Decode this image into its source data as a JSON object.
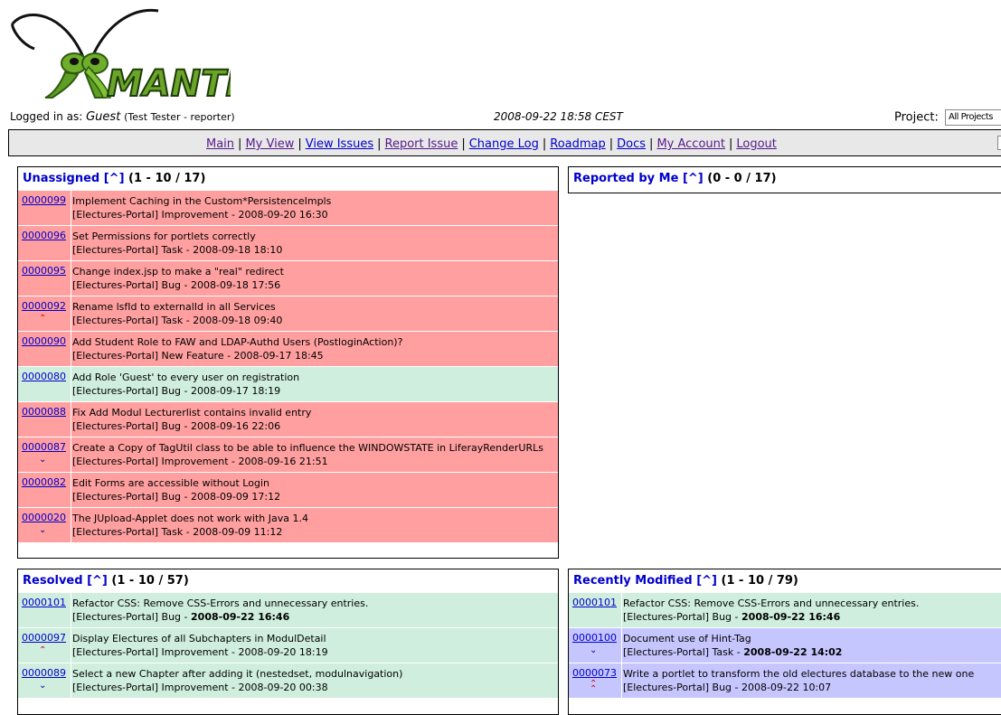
{
  "logo_text": "MANTIS",
  "login": {
    "label": "Logged in as:",
    "user": "Guest",
    "detail": "(Test Tester - reporter)",
    "datetime": "2008-09-22 18:58 CEST",
    "project_label": "Project:",
    "project_value": "All Projects"
  },
  "menu": [
    "Main",
    "My View",
    "View Issues",
    "Report Issue",
    "Change Log",
    "Roadmap",
    "Docs",
    "My Account",
    "Logout"
  ],
  "unassigned": {
    "title": "Unassigned",
    "link": "[^]",
    "count": "(1 - 10 / 17)",
    "rows": [
      {
        "id": "0000099",
        "summary": "Implement Caching in the Custom*PersistenceImpls",
        "meta": "[Electures-Portal] Improvement - 2008-09-20 16:30",
        "color": "red",
        "pri": ""
      },
      {
        "id": "0000096",
        "summary": "Set Permissions for portlets correctly",
        "meta": "[Electures-Portal] Task - 2008-09-18 18:10",
        "color": "red",
        "pri": ""
      },
      {
        "id": "0000095",
        "summary": "Change index.jsp to make a \"real\" redirect",
        "meta": "[Electures-Portal] Bug - 2008-09-18 17:56",
        "color": "red",
        "pri": ""
      },
      {
        "id": "0000092",
        "summary": "Rename lsfId to externalId in all Services",
        "meta": "[Electures-Portal] Task - 2008-09-18 09:40",
        "color": "red",
        "pri": "up"
      },
      {
        "id": "0000090",
        "summary": "Add Student Role to FAW and LDAP-Authd Users (PostloginAction)?",
        "meta": "[Electures-Portal] New Feature - 2008-09-17 18:45",
        "color": "red",
        "pri": ""
      },
      {
        "id": "0000080",
        "summary": "Add Role 'Guest' to every user on registration",
        "meta": "[Electures-Portal] Bug - 2008-09-17 18:19",
        "color": "green",
        "pri": ""
      },
      {
        "id": "0000088",
        "summary": "Fix Add Modul Lecturerlist contains invalid entry",
        "meta": "[Electures-Portal] Bug - 2008-09-16 22:06",
        "color": "red",
        "pri": ""
      },
      {
        "id": "0000087",
        "summary": "Create a Copy of TagUtil class to be able to influence the WINDOWSTATE in LiferayRenderURLs",
        "meta": "[Electures-Portal] Improvement - 2008-09-16 21:51",
        "color": "red",
        "pri": "down"
      },
      {
        "id": "0000082",
        "summary": "Edit Forms are accessible without Login",
        "meta": "[Electures-Portal] Bug - 2008-09-09 17:12",
        "color": "red",
        "pri": ""
      },
      {
        "id": "0000020",
        "summary": "The JUpload-Applet does not work with Java 1.4",
        "meta": "[Electures-Portal] Task - 2008-09-09 11:12",
        "color": "red",
        "pri": "down"
      }
    ]
  },
  "reported": {
    "title": "Reported by Me",
    "link": "[^]",
    "count": "(0 - 0 / 17)"
  },
  "resolved": {
    "title": "Resolved",
    "link": "[^]",
    "count": "(1 - 10 / 57)",
    "rows": [
      {
        "id": "0000101",
        "summary": "Refactor CSS: Remove CSS-Errors and unnecessary entries.",
        "meta_prefix": "[Electures-Portal] Bug - ",
        "meta_ts": "2008-09-22 16:46",
        "bold": true,
        "color": "green",
        "pri": ""
      },
      {
        "id": "0000097",
        "summary": "Display Electures of all Subchapters in ModulDetail",
        "meta_prefix": "[Electures-Portal] Improvement - ",
        "meta_ts": "2008-09-20 18:19",
        "bold": false,
        "color": "green",
        "pri": "up"
      },
      {
        "id": "0000089",
        "summary": "Select a new Chapter after adding it (nestedset, modulnavigation)",
        "meta_prefix": "[Electures-Portal] Improvement - ",
        "meta_ts": "2008-09-20 00:38",
        "bold": false,
        "color": "green",
        "pri": "down"
      }
    ]
  },
  "recent": {
    "title": "Recently Modified",
    "link": "[^]",
    "count": "(1 - 10 / 79)",
    "rows": [
      {
        "id": "0000101",
        "summary": "Refactor CSS: Remove CSS-Errors and unnecessary entries.",
        "meta_prefix": "[Electures-Portal] Bug - ",
        "meta_ts": "2008-09-22 16:46",
        "bold": true,
        "color": "green",
        "pri": ""
      },
      {
        "id": "0000100",
        "summary": "Document use of Hint-Tag",
        "meta_prefix": "[Electures-Portal] Task - ",
        "meta_ts": "2008-09-22 14:02",
        "bold": true,
        "color": "purple",
        "pri": "down"
      },
      {
        "id": "0000073",
        "summary": "Write a portlet to transform the old electures database to the new one",
        "meta_prefix": "[Electures-Portal] Bug - ",
        "meta_ts": "2008-09-22 10:07",
        "bold": false,
        "color": "purple",
        "pri": "upup"
      }
    ]
  },
  "colors": {
    "red": "#ff9f9f",
    "green": "#cfeedd",
    "purple": "#c6c6ff",
    "link": "#0000cc",
    "visited": "#551a8b"
  }
}
